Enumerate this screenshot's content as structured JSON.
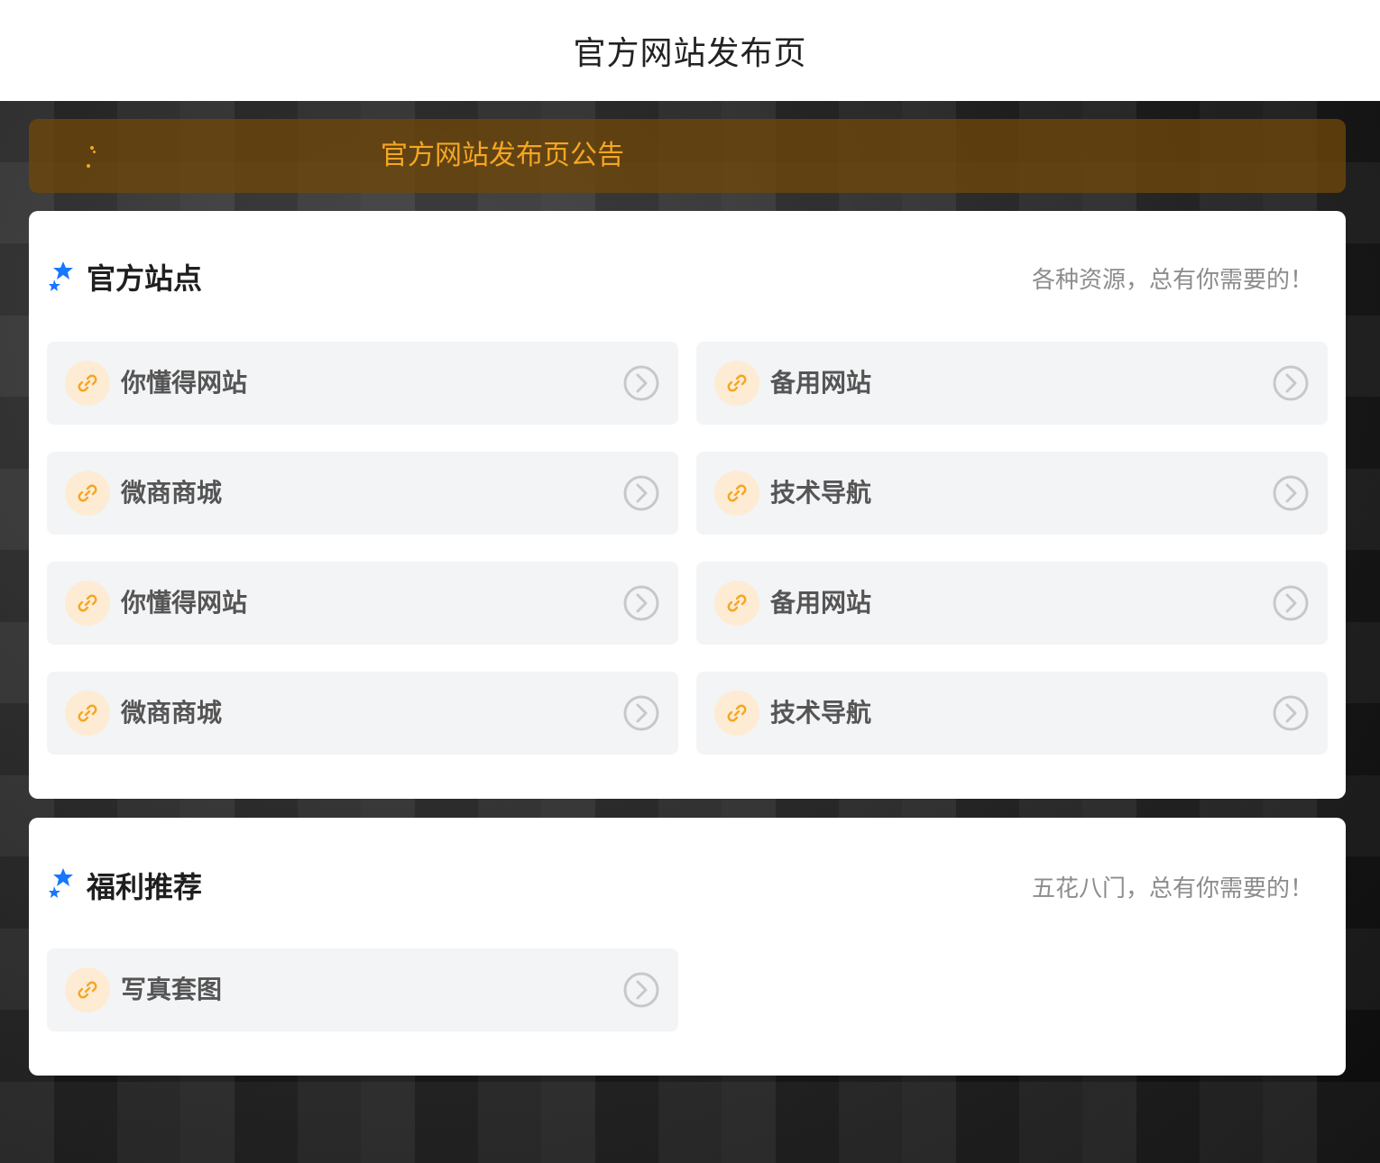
{
  "header": {
    "title": "官方网站发布页"
  },
  "notice": {
    "text": "官方网站发布页公告"
  },
  "sections": [
    {
      "title": "官方站点",
      "subtitle": "各种资源，总有你需要的！",
      "links": [
        {
          "label": "你懂得网站"
        },
        {
          "label": "备用网站"
        },
        {
          "label": "微商商城"
        },
        {
          "label": "技术导航"
        },
        {
          "label": "你懂得网站"
        },
        {
          "label": "备用网站"
        },
        {
          "label": "微商商城"
        },
        {
          "label": "技术导航"
        }
      ]
    },
    {
      "title": "福利推荐",
      "subtitle": "五花八门，总有你需要的！",
      "links": [
        {
          "label": "写真套图"
        }
      ]
    }
  ],
  "icons": {
    "section_icon": "star-badge-icon",
    "link_icon": "link-icon",
    "arrow_icon": "chevron-right-circle-icon"
  },
  "colors": {
    "accent_orange": "#f5a623",
    "accent_blue": "#1677ff",
    "notice_bg": "#6e480a"
  }
}
